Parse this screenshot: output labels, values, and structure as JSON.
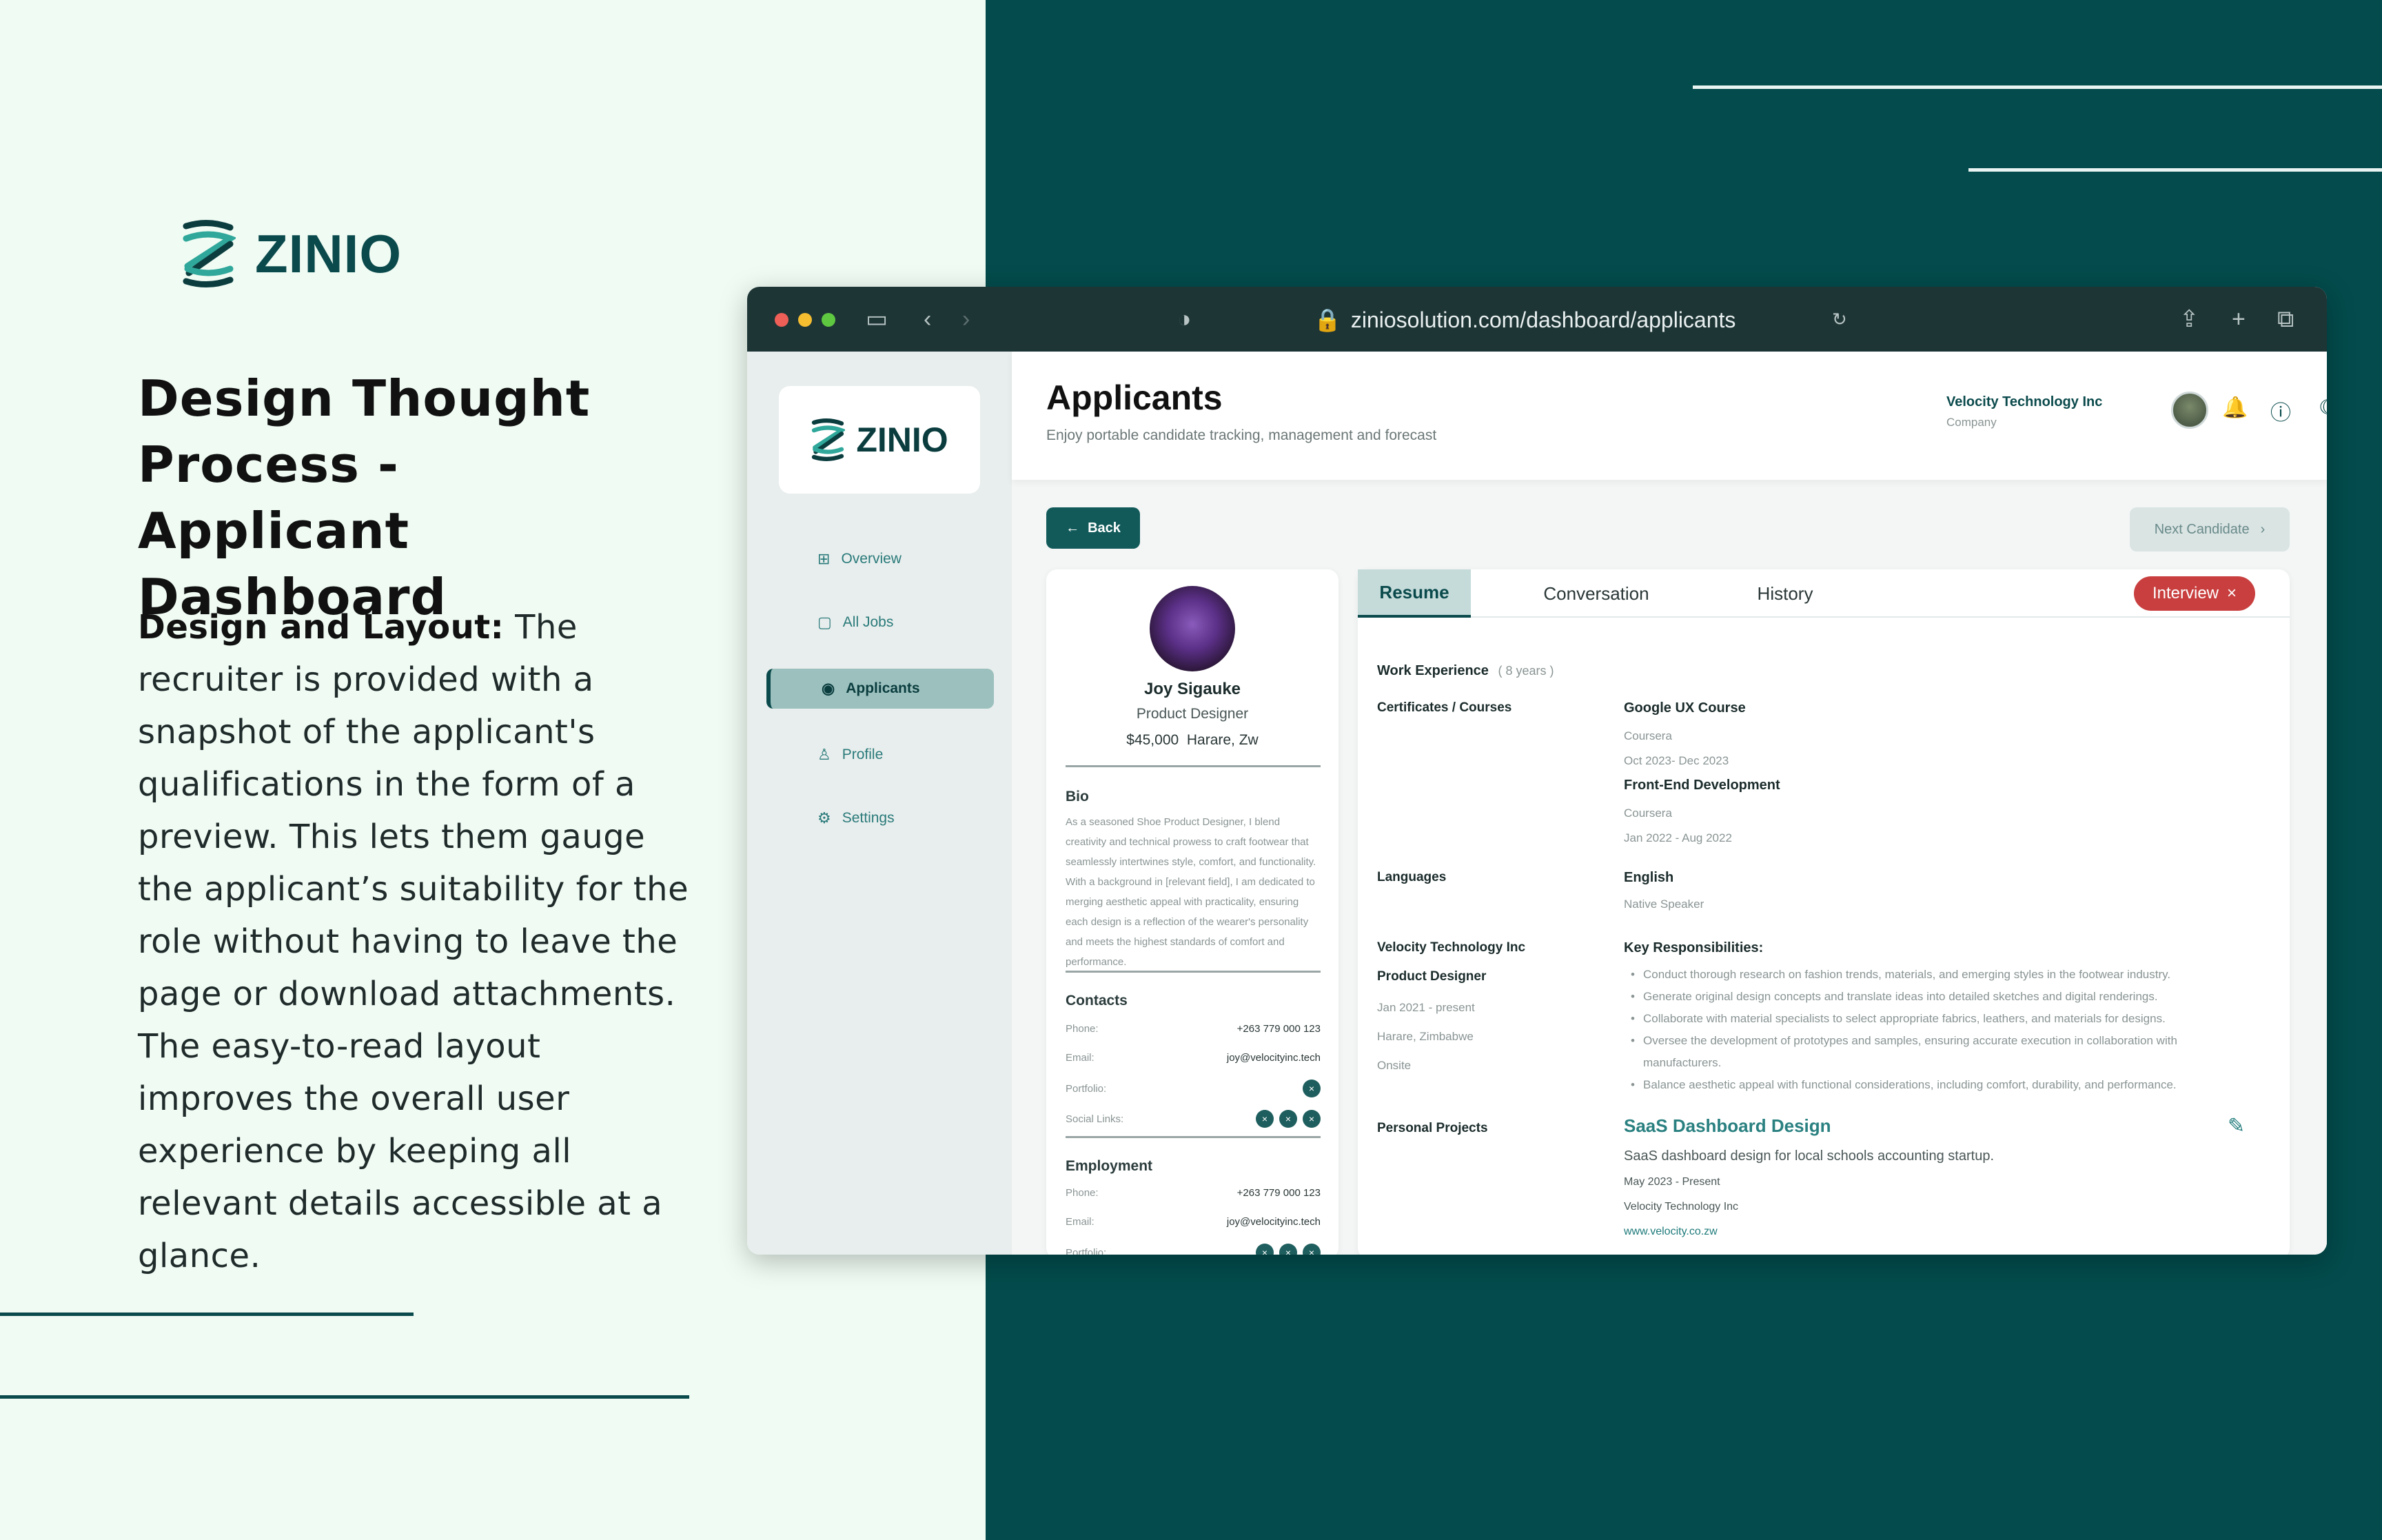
{
  "brand": {
    "name": "ZINIO"
  },
  "headline": [
    "Design Thought",
    "Process -",
    "Applicant Dashboard"
  ],
  "copy": {
    "lead": "Design and Layout:",
    "body": " The recruiter is provided with a snapshot of the applicant's qualifications in the form of a preview. This lets them gauge the applicant’s suitability for the role without having to leave the page or download attachments. The easy-to-read layout improves the overall user experience by keeping all relevant details accessible at a glance."
  },
  "browser": {
    "url": "ziniosolution.com/dashboard/applicants",
    "icons": [
      "sidebar-toggle-icon",
      "back-arrow-icon",
      "forward-arrow-icon",
      "shield-icon",
      "lock-icon",
      "reload-icon",
      "share-icon",
      "new-tab-icon",
      "tabs-icon"
    ]
  },
  "sidebar": {
    "logo": "ZINIO",
    "items": [
      {
        "label": "Overview",
        "icon": "grid-icon",
        "active": false
      },
      {
        "label": "All Jobs",
        "icon": "briefcase-icon",
        "active": false
      },
      {
        "label": "Applicants",
        "icon": "user-circle-icon",
        "active": true
      },
      {
        "label": "Profile",
        "icon": "person-icon",
        "active": false
      },
      {
        "label": "Settings",
        "icon": "gear-icon",
        "active": false
      }
    ]
  },
  "header": {
    "title": "Applicants",
    "subtitle": "Enjoy portable candidate tracking, management and forecast",
    "company_name": "Velocity Technology Inc",
    "company_role": "Company"
  },
  "actions": {
    "back": "Back",
    "next": "Next Candidate"
  },
  "candidate": {
    "name": "Joy Sigauke",
    "role": "Product Designer",
    "salary": "$45,000",
    "location": "Harare, Zw",
    "bio_title": "Bio",
    "bio": "As a seasoned Shoe Product Designer, I blend creativity and technical prowess to craft footwear that seamlessly intertwines style, comfort, and functionality. With a background in [relevant field], I am dedicated to merging aesthetic appeal with practicality, ensuring each design is a reflection of the wearer's personality and meets the highest standards of comfort and performance.",
    "contacts_title": "Contacts",
    "contacts": {
      "phone_label": "Phone:",
      "phone": "+263 779 000 123",
      "email_label": "Email:",
      "email": "joy@velocityinc.tech",
      "portfolio_label": "Portfolio:",
      "social_label": "Social Links:"
    },
    "employment_title": "Employment",
    "employment": {
      "phone_label": "Phone:",
      "phone": "+263 779 000 123",
      "email_label": "Email:",
      "email": "joy@velocityinc.tech",
      "portfolio_label": "Portfolio:"
    }
  },
  "tabs": [
    {
      "label": "Resume",
      "active": true
    },
    {
      "label": "Conversation",
      "active": false
    },
    {
      "label": "History",
      "active": false
    }
  ],
  "status_badge": {
    "label": "Interview",
    "color": "#c93f3f"
  },
  "resume": {
    "work_title": "Work Experience",
    "work_years": "( 8 years )",
    "certs_label": "Certificates / Courses",
    "certs": [
      {
        "name": "Google UX Course",
        "org": "Coursera",
        "dates": "Oct 2023- Dec 2023"
      },
      {
        "name": "Front-End Development",
        "org": "Coursera",
        "dates": "Jan 2022 - Aug 2022"
      }
    ],
    "languages_label": "Languages",
    "language": "English",
    "language_level": "Native Speaker",
    "job": {
      "company": "Velocity Technology Inc",
      "title": "Product Designer",
      "dates": "Jan 2021 - present",
      "location": "Harare, Zimbabwe",
      "mode": "Onsite"
    },
    "resp_title": "Key Responsibilities:",
    "responsibilities": [
      "Conduct thorough research on fashion trends, materials, and emerging styles in the footwear industry.",
      "Generate original design concepts and translate ideas into detailed sketches and digital renderings.",
      "Collaborate with material specialists to select appropriate fabrics, leathers, and materials for designs.",
      "Oversee the development of prototypes and samples, ensuring accurate execution in collaboration with manufacturers.",
      "Balance aesthetic appeal with functional considerations, including comfort, durability, and performance."
    ],
    "projects_label": "Personal Projects",
    "project": {
      "name": "SaaS Dashboard Design",
      "desc": "SaaS dashboard design for local schools accounting startup.",
      "dates": "May 2023 - Present",
      "org": "Velocity Technology Inc",
      "url": "www.velocity.co.zw"
    }
  },
  "colors": {
    "brand": "#0b4a4c",
    "background_dark": "#034b4c",
    "background_light": "#effbf3",
    "accent": "#125a5a"
  }
}
